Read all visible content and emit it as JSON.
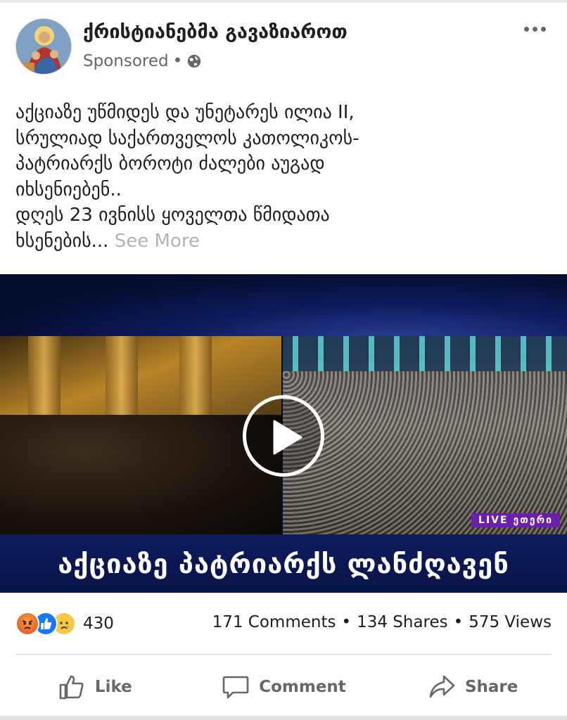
{
  "post": {
    "page_name": "ქრისტიანებმა გავაზიაროთ",
    "sponsored_label": "Sponsored",
    "meta_separator": "•",
    "privacy_icon": "globe-icon",
    "more_icon": "more-options-icon",
    "text_lines": [
      "აქციაზე უწმიდეს და უნეტარეს ილია II,",
      "სრულიად საქართველოს კათოლიკოს-",
      "პატრიარქს  ბოროტი ძალები აუგად",
      "იხსენიებენ..",
      "დღეს 23 ივნისს ყოველთა წმიდათა",
      "ხსენების..."
    ],
    "see_more": "See More"
  },
  "video": {
    "caption": "აქციაზე პატრიარქს ლანძღავენ",
    "live_tag": "LIVE ეთერი",
    "play_icon": "play-icon"
  },
  "stats": {
    "reaction_icons": [
      "angry-reaction-icon",
      "like-reaction-icon",
      "sad-reaction-icon"
    ],
    "reaction_count": "430",
    "comments": "171 Comments",
    "shares": "134 Shares",
    "views": "575 Views",
    "separator": "•"
  },
  "actions": {
    "like": "Like",
    "comment": "Comment",
    "share": "Share"
  },
  "colors": {
    "text_primary": "#1c1e21",
    "text_secondary": "#65676b",
    "see_more": "#b0b3b8",
    "like_blue": "#1877f2",
    "caption_band": "#0f1b5e"
  }
}
